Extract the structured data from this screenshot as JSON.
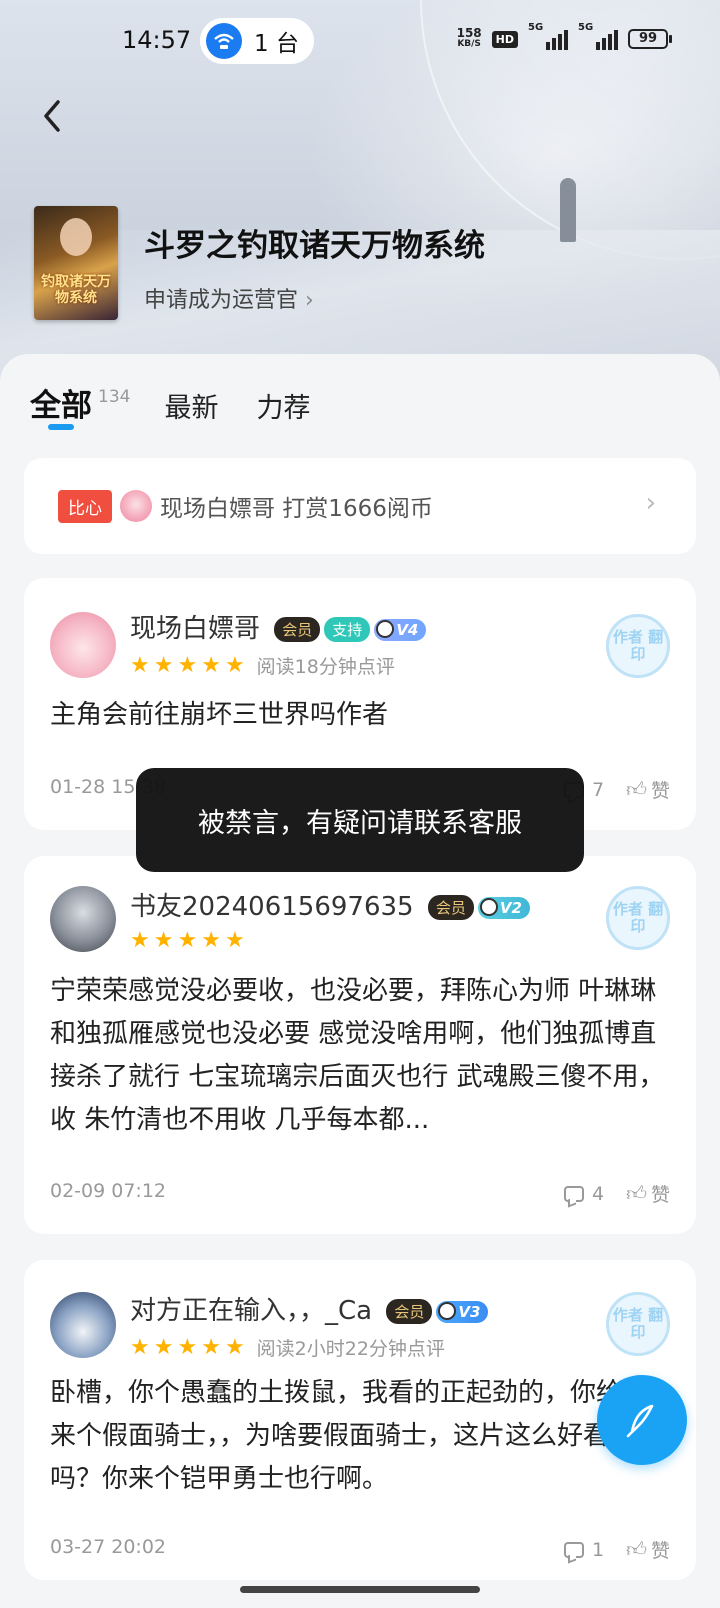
{
  "status_bar": {
    "time": "14:57",
    "cast_count": "1 台",
    "net_speed_value": "158",
    "net_speed_unit": "KB/S",
    "hd_label": "HD",
    "signal1_label": "5G",
    "signal2_label": "5G",
    "battery": "99"
  },
  "book": {
    "title": "斗罗之钓取诸天万物系统",
    "apply_operator": "申请成为运营官",
    "cover_text": "钓取诸天万物系统"
  },
  "tabs": {
    "all_label": "全部",
    "all_count": "134",
    "latest_label": "最新",
    "recommend_label": "力荐"
  },
  "reward": {
    "tag": "比心",
    "text": "现场白嫖哥  打赏1666阅币"
  },
  "reviews": [
    {
      "username": "现场白嫖哥",
      "vip_badge": "会员",
      "support_badge": "支持",
      "level_badge": "V4",
      "read_time": "阅读18分钟点评",
      "stamp": "作者 翻印",
      "content": "主角会前往崩坏三世界吗作者",
      "date": "01-28 15:38",
      "comment_count": "7",
      "like_label": "赞"
    },
    {
      "username": "书友20240615697635",
      "vip_badge": "会员",
      "level_badge": "V2",
      "stamp": "作者 翻印",
      "content": "宁荣荣感觉没必要收，也没必要，拜陈心为师 叶琳琳和独孤雁感觉也没必要 感觉没啥用啊，他们独孤博直接杀了就行 七宝琉璃宗后面灭也行 武魂殿三傻不用，收 朱竹清也不用收 几乎每本都...",
      "date": "02-09 07:12",
      "comment_count": "4",
      "like_label": "赞"
    },
    {
      "username": "对方正在输入，，_Ca",
      "vip_badge": "会员",
      "level_badge": "V3",
      "read_time": "阅读2小时22分钟点评",
      "stamp": "作者 翻印",
      "content": "卧槽，你个愚蠢的土拨鼠，我看的正起劲的，你给我来个假面骑士，，为啥要假面骑士，这片这么好看的吗？你来个铠甲勇士也行啊。",
      "date": "03-27 20:02",
      "comment_count": "1",
      "like_label": "赞"
    }
  ],
  "toast": "被禁言，有疑问请联系客服",
  "icons": {
    "back": "chevron-left-icon",
    "fab": "quill-pen-icon",
    "star_color": "#ffb300",
    "accent": "#1aa3f5"
  }
}
